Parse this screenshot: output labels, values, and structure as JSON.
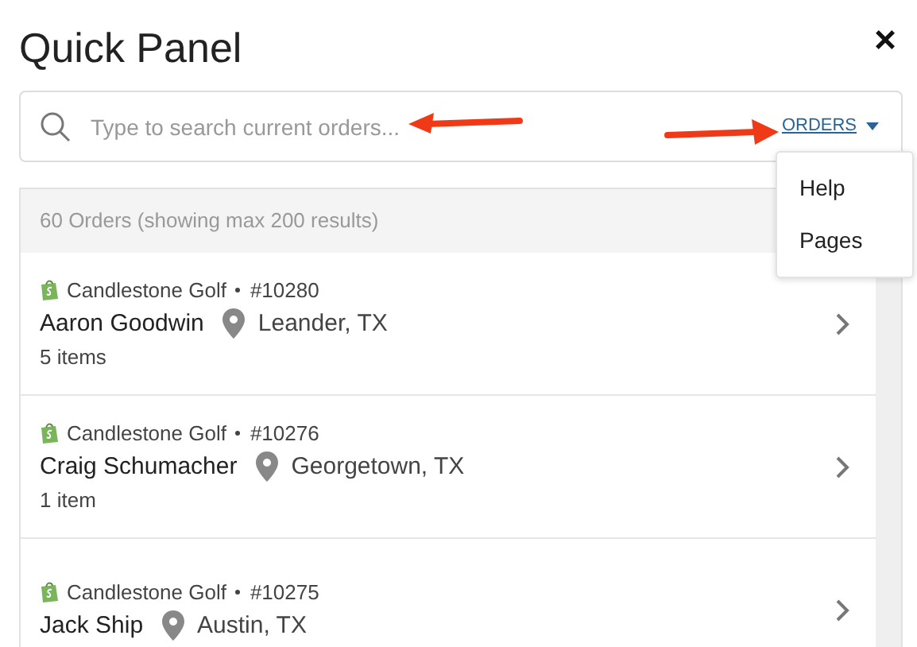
{
  "panel": {
    "title": "Quick Panel",
    "close": "×"
  },
  "search": {
    "placeholder": "Type to search current orders...",
    "scope": "ORDERS"
  },
  "menu": {
    "items": [
      {
        "label": "Help"
      },
      {
        "label": "Pages"
      }
    ]
  },
  "results": {
    "summary": "60 Orders (showing max 200 results)",
    "orders": [
      {
        "store": "Candlestone Golf",
        "number": "#10280",
        "customer": "Aaron Goodwin",
        "location": "Leander, TX",
        "items": "5 items"
      },
      {
        "store": "Candlestone Golf",
        "number": "#10276",
        "customer": "Craig Schumacher",
        "location": "Georgetown, TX",
        "items": "1 item"
      },
      {
        "store": "Candlestone Golf",
        "number": "#10275",
        "customer": "Jack Ship",
        "location": "Austin, TX"
      }
    ]
  }
}
